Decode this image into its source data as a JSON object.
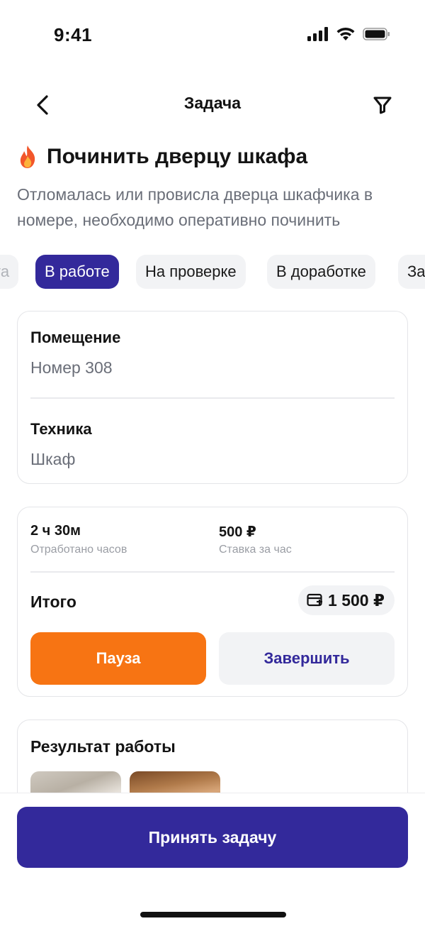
{
  "status_bar": {
    "time": "9:41"
  },
  "nav": {
    "title": "Задача"
  },
  "task": {
    "title": "Починить дверцу шкафа",
    "description": "Отломалась или провисла дверца шкафчика в номере, необходимо оперативно починить"
  },
  "status_chips": [
    {
      "label": "та",
      "state": "faded"
    },
    {
      "label": "В работе",
      "state": "active"
    },
    {
      "label": "На проверке",
      "state": "default"
    },
    {
      "label": "В доработке",
      "state": "default"
    },
    {
      "label": "За",
      "state": "default"
    }
  ],
  "info": {
    "room_label": "Помещение",
    "room_value": "Номер 308",
    "equipment_label": "Техника",
    "equipment_value": "Шкаф"
  },
  "work": {
    "hours_value": "2 ч 30м",
    "hours_label": "Отработано часов",
    "rate_value": "500 ₽",
    "rate_label": "Ставка за час",
    "total_label": "Итого",
    "total_value": "1 500 ₽",
    "pause_label": "Пауза",
    "finish_label": "Завершить"
  },
  "result": {
    "title": "Результат работы"
  },
  "footer": {
    "accept_label": "Принять задачу"
  },
  "colors": {
    "accent": "#33299b",
    "pause": "#f77413",
    "chip_bg": "#f2f3f5",
    "muted_text": "#6a6e78"
  }
}
